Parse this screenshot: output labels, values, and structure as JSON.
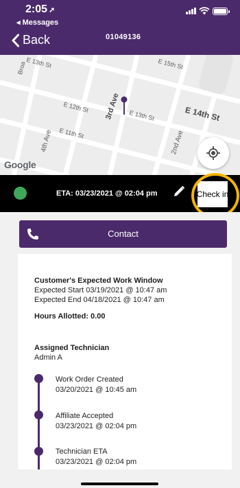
{
  "status_bar": {
    "time": "2:05",
    "back_app": "◂ Messages"
  },
  "header": {
    "back_label": "Back",
    "title": "01049136"
  },
  "map": {
    "streets": [
      "Broa",
      "E 13th St",
      "E 15th St",
      "3rd Ave",
      "E 12th St",
      "E 13th St",
      "E 14th St",
      "4th Ave",
      "E 11th St",
      "2nd Ave"
    ],
    "logo": "Google"
  },
  "eta_bar": {
    "status_color": "#3fa75a",
    "eta_text": "ETA: 03/23/2021 @ 02:04 pm",
    "checkin_label": "Check in"
  },
  "contact": {
    "label": "Contact"
  },
  "details": {
    "work_window_title": "Customer's Expected Work Window",
    "expected_start": "Expected Start 03/19/2021 @ 10:47 am",
    "expected_end": "Expected End 04/18/2021 @ 10:47 am",
    "hours_allotted": "Hours Allotted: 0.00",
    "technician_title": "Assigned Technician",
    "technician_name": "Admin A"
  },
  "timeline": [
    {
      "title": "Work Order Created",
      "time": "03/20/2021 @ 10:45 am"
    },
    {
      "title": "Affiliate Accepted",
      "time": "03/23/2021 @ 02:04 pm"
    },
    {
      "title": "Technician ETA",
      "time": "03/23/2021 @ 02:04 pm"
    }
  ],
  "colors": {
    "brand": "#4b2a6b",
    "highlight": "#f5b400"
  }
}
